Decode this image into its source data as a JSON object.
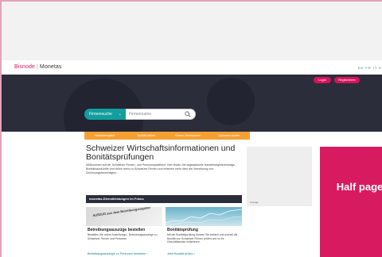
{
  "header": {
    "logo_part1": "Bisnode",
    "logo_part2": "Monetas",
    "languages": "DE FR IT E"
  },
  "auth": {
    "login": "Login",
    "register": "Registrieren"
  },
  "search": {
    "select_label": "Firmensuche",
    "placeholder": "Firmenname"
  },
  "tabs": [
    {
      "label": "Handelsregister"
    },
    {
      "label": "Bonität prüfen"
    },
    {
      "label": "Firmen überwachen"
    },
    {
      "label": "Adressen kaufen"
    }
  ],
  "main": {
    "headline": "Schweizer Wirtschaftsinformationen und Bonitätsprüfungen",
    "intro": "Willkommen auf der Schweizer Firmen- und Personenplattform. Hier finden Sie tagesaktuelle Handelsregistereinträge, Bonitätsauskünfte und vieles mehr zu Schweizer Firmen und erfahren mehr über die Vernetzung von Zeichnungsberechtigten."
  },
  "services": {
    "bar_title": "monetas-Dienstleistungen im Fokus",
    "cards": [
      {
        "image_text": "AUSZUG aus dem Betreibungsregister",
        "title": "Betreibungsauszüge bestellen",
        "text": "Bestellen Sie online Ausleihungs-, Betreibungsauszüge zu Schweizer Firmen und Personen.",
        "link": "Betreibungsauszüge zu Personen bestellen  ›"
      },
      {
        "title": "Bonitätsprüfung",
        "text": "Mit der Bonitätsprüfung können Sie einfach und schnell die Bonität von Schweizer Firmen prüfen und so Ihr Geschäftsrisiko minimieren.",
        "link": "Jetzt Bonität prüfen  ›"
      }
    ]
  },
  "ads": {
    "sidebox_label": "Anzeige",
    "halfpage": "Half page"
  },
  "colors": {
    "brand_pink": "#d4145a",
    "teal": "#139e9e",
    "orange": "#f6a034",
    "dark": "#2b2d3b"
  }
}
